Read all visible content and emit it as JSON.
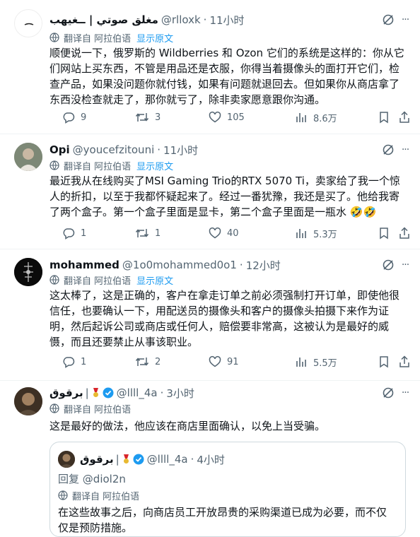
{
  "tweets": [
    {
      "name": "مغلق صوتي | ــغيهب",
      "handle": "@rlloxk",
      "time": "11小时",
      "translated": "翻译自 阿拉伯语",
      "show_original": "显示原文",
      "text": "顺便说一下，俄罗斯的 Wildberries 和 Ozon 它们的系统是这样的：你从它们网站上买东西，不管是用品还是衣服，你得当着摄像头的面打开它们，检查产品，如果没问题你就付钱，如果有问题就退回去。但如果你从商店拿了东西没检查就走了，那你就亏了，除非卖家愿意跟你沟通。",
      "replies": "9",
      "retweets": "3",
      "likes": "105",
      "views": "8.6万"
    },
    {
      "name": "Opi",
      "handle": "@youcefzitouni",
      "time": "11小时",
      "translated": "翻译自 阿拉伯语",
      "show_original": "显示原文",
      "text": "最近我从在线购买了MSI Gaming Trio的RTX 5070 Ti，卖家给了我一个惊人的折扣，以至于我都怀疑起来了。经过一番犹豫，我还是买了。他给我寄了两个盒子。第一个盒子里面是显卡，第二个盒子里面是一瓶水 🤣🤣",
      "replies": "1",
      "retweets": "1",
      "likes": "40",
      "views": "5.3万"
    },
    {
      "name": "mohammed",
      "handle": "@1o0mohammed0o1",
      "time": "12小时",
      "translated": "翻译自 阿拉伯语",
      "show_original": "显示原文",
      "text": "这太棒了，这是正确的，客户在拿走订单之前必须强制打开订单，即使他很信任，也要确认一下，用配送员的摄像头和客户的摄像头拍摄下来作为证明，然后起诉公司或商店或任何人，赔偿要非常高，这被认为是最好的威慑，而且还要禁止从事该职业。",
      "replies": "1",
      "retweets": "2",
      "likes": "91",
      "views": "5.5万"
    },
    {
      "name": "برقوق",
      "handle": "@llll_4a",
      "time": "3小时",
      "translated": "翻译自 阿拉伯语",
      "text": "这是最好的做法，他应该在商店里面确认，以免上当受骗。"
    }
  ],
  "quote": {
    "name": "برقوق",
    "handle": "@llll_4a",
    "time": "4小时",
    "reply_to_prefix": "回复",
    "reply_to": "@diol2n",
    "translated": "翻译自 阿拉伯语",
    "text": "在这些故事之后，向商店员工开放昂贵的采购渠道已成为必要，而不仅仅是预防措施。"
  },
  "colors": {
    "muted": "#536471",
    "link": "#1d9bf0",
    "border": "#eff3f4",
    "text": "#0f1419"
  }
}
